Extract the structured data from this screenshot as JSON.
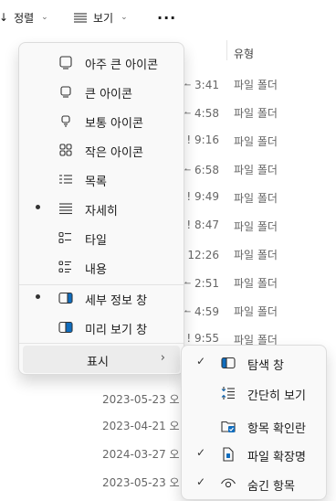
{
  "toolbar": {
    "sort_label": "정렬",
    "view_label": "보기",
    "more_label": "···"
  },
  "file_list": {
    "type_header": "유형",
    "rows": [
      {
        "date": "ᅩ 3:41",
        "type": "파일 폴더"
      },
      {
        "date": "ᅩ 4:58",
        "type": "파일 폴더"
      },
      {
        "date": "! 9:16",
        "type": "파일 폴더"
      },
      {
        "date": "ᅩ 6:58",
        "type": "파일 폴더"
      },
      {
        "date": "! 9:49",
        "type": "파일 폴더"
      },
      {
        "date": "! 8:47",
        "type": "파일 폴더"
      },
      {
        "date": "ᅩ 12:26",
        "type": "파일 폴더"
      },
      {
        "date": "ᅩ 2:51",
        "type": "파일 폴더"
      },
      {
        "date": "ᅩ 4:59",
        "type": "파일 폴더"
      },
      {
        "date": "! 9:55",
        "type": "파일 폴더"
      },
      {
        "date": "2023-05-23 오",
        "type": ""
      },
      {
        "date": "2023-04-21 오",
        "type": ""
      },
      {
        "date": "2024-03-27 오",
        "type": ""
      },
      {
        "date": "2023-05-23 오",
        "type": ""
      }
    ]
  },
  "view_menu": {
    "items": [
      {
        "label": "아주 큰 아이콘",
        "icon": "extra-large-icons-icon",
        "selected": false
      },
      {
        "label": "큰 아이콘",
        "icon": "large-icons-icon",
        "selected": false
      },
      {
        "label": "보통 아이콘",
        "icon": "medium-icons-icon",
        "selected": false
      },
      {
        "label": "작은 아이콘",
        "icon": "small-icons-icon",
        "selected": false
      },
      {
        "label": "목록",
        "icon": "list-icon",
        "selected": false
      },
      {
        "label": "자세히",
        "icon": "details-icon",
        "selected": true
      },
      {
        "label": "타일",
        "icon": "tiles-icon",
        "selected": false
      },
      {
        "label": "내용",
        "icon": "content-icon",
        "selected": false
      }
    ],
    "panes": [
      {
        "label": "세부 정보 창",
        "icon": "details-pane-icon",
        "selected": true
      },
      {
        "label": "미리 보기 창",
        "icon": "preview-pane-icon",
        "selected": false
      }
    ],
    "show_label": "표시",
    "show_arrow": "›"
  },
  "show_submenu": {
    "items": [
      {
        "label": "탐색 창",
        "icon": "navigation-pane-icon",
        "checked": true
      },
      {
        "label": "간단히 보기",
        "icon": "compact-view-icon",
        "checked": false
      },
      {
        "label": "항목 확인란",
        "icon": "item-checkboxes-icon",
        "checked": false
      },
      {
        "label": "파일 확장명",
        "icon": "file-extensions-icon",
        "checked": true
      },
      {
        "label": "숨긴 항목",
        "icon": "hidden-items-icon",
        "checked": true
      }
    ],
    "check_glyph": "✓"
  },
  "colors": {
    "accent": "#0f6cbd",
    "menu_bg": "#f9f9f9",
    "hover_bg": "#ececec"
  }
}
